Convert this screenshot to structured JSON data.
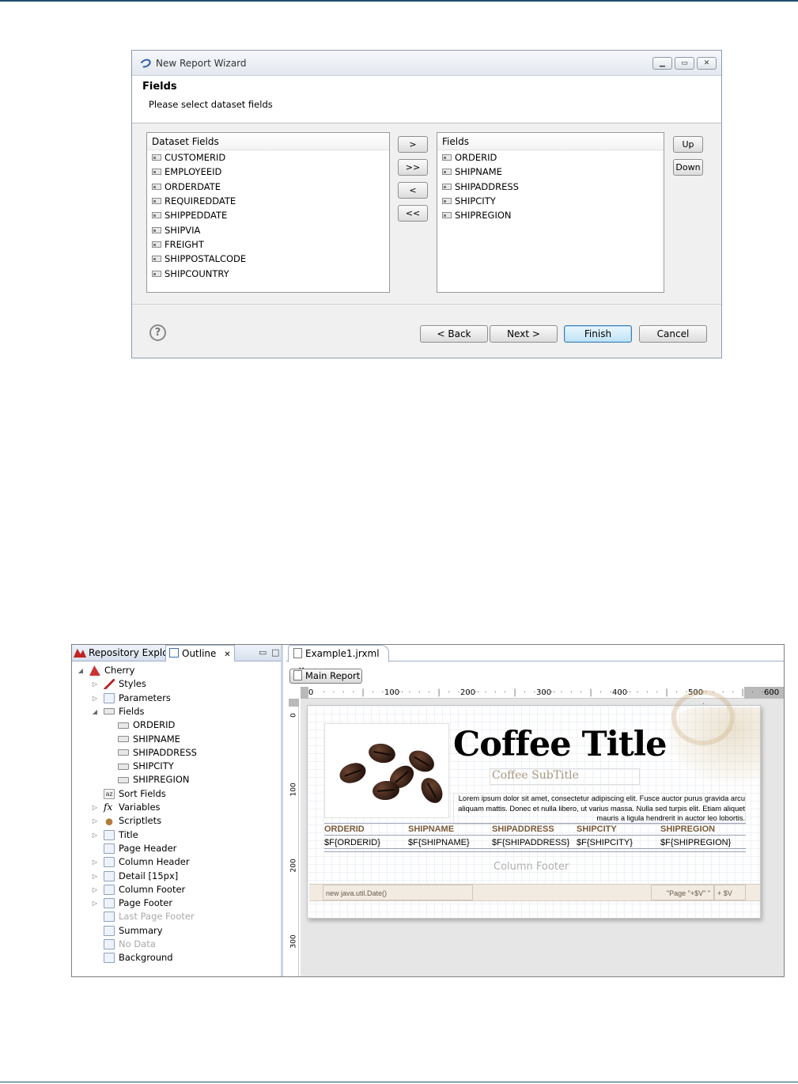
{
  "wizard": {
    "title": "New Report Wizard",
    "header_title": "Fields",
    "header_desc": "Please select dataset fields",
    "dataset_fields_label": "Dataset Fields",
    "dataset_fields": [
      "CUSTOMERID",
      "EMPLOYEEID",
      "ORDERDATE",
      "REQUIREDDATE",
      "SHIPPEDDATE",
      "SHIPVIA",
      "FREIGHT",
      "SHIPPOSTALCODE",
      "SHIPCOUNTRY"
    ],
    "fields_label": "Fields",
    "fields": [
      "ORDERID",
      "SHIPNAME",
      "SHIPADDRESS",
      "SHIPCITY",
      "SHIPREGION"
    ],
    "move_buttons": {
      "add": ">",
      "add_all": ">>",
      "remove": "<",
      "remove_all": "<<"
    },
    "order_buttons": {
      "up": "Up",
      "down": "Down"
    },
    "dialog_buttons": {
      "back": "< Back",
      "next": "Next >",
      "finish": "Finish",
      "cancel": "Cancel"
    },
    "help": "?"
  },
  "ide": {
    "tabs": {
      "repository": "Repository Explore",
      "outline": "Outline"
    },
    "tree": {
      "root": "Cherry",
      "items": [
        {
          "label": "Styles",
          "twisty": "▷",
          "icon": "pen",
          "indent": 1
        },
        {
          "label": "Parameters",
          "twisty": "▷",
          "icon": "doc",
          "indent": 1
        },
        {
          "label": "Fields",
          "twisty": "◢",
          "icon": "field",
          "indent": 1
        },
        {
          "label": "ORDERID",
          "twisty": "",
          "icon": "field",
          "indent": 2
        },
        {
          "label": "SHIPNAME",
          "twisty": "",
          "icon": "field",
          "indent": 2
        },
        {
          "label": "SHIPADDRESS",
          "twisty": "",
          "icon": "field",
          "indent": 2
        },
        {
          "label": "SHIPCITY",
          "twisty": "",
          "icon": "field",
          "indent": 2
        },
        {
          "label": "SHIPREGION",
          "twisty": "",
          "icon": "field",
          "indent": 2
        },
        {
          "label": "Sort Fields",
          "twisty": "",
          "icon": "az",
          "indent": 1
        },
        {
          "label": "Variables",
          "twisty": "▷",
          "icon": "fx",
          "indent": 1
        },
        {
          "label": "Scriptlets",
          "twisty": "▷",
          "icon": "cup",
          "indent": 1
        },
        {
          "label": "Title",
          "twisty": "▷",
          "icon": "doc",
          "indent": 1
        },
        {
          "label": "Page Header",
          "twisty": "",
          "icon": "doc",
          "indent": 1
        },
        {
          "label": "Column Header",
          "twisty": "▷",
          "icon": "doc",
          "indent": 1
        },
        {
          "label": "Detail [15px]",
          "twisty": "▷",
          "icon": "doc",
          "indent": 1
        },
        {
          "label": "Column Footer",
          "twisty": "▷",
          "icon": "doc",
          "indent": 1
        },
        {
          "label": "Page Footer",
          "twisty": "▷",
          "icon": "doc",
          "indent": 1
        },
        {
          "label": "Last Page Footer",
          "twisty": "",
          "icon": "doc",
          "indent": 1,
          "disabled": true
        },
        {
          "label": "Summary",
          "twisty": "",
          "icon": "doc",
          "indent": 1
        },
        {
          "label": "No Data",
          "twisty": "",
          "icon": "doc",
          "indent": 1,
          "disabled": true
        },
        {
          "label": "Background",
          "twisty": "",
          "icon": "doc",
          "indent": 1
        }
      ]
    },
    "editor_tab": "Example1.jrxml",
    "main_report_button": "Main Report",
    "ruler_h": [
      "0",
      "100",
      "200",
      "300",
      "400",
      "500",
      "600"
    ],
    "ruler_v": [
      "0",
      "100",
      "200",
      "300"
    ],
    "report": {
      "title": "Coffee Title",
      "subtitle": "Coffee SubTitle",
      "lorem": "Lorem ipsum dolor sit amet, consectetur adipiscing elit. Fusce auctor purus gravida arcu aliquam mattis. Donec et nulla libero, ut varius massa. Nulla sed turpis elit. Etiam aliquet mauris a ligula hendrerit in auctor leo lobortis.",
      "column_headers": [
        "ORDERID",
        "SHIPNAME",
        "SHIPADDRESS",
        "SHIPCITY",
        "SHIPREGION"
      ],
      "detail_fields": [
        "$F{ORDERID}",
        "$F{SHIPNAME}",
        "$F{SHIPADDRESS}",
        "$F{SHIPCITY}",
        "$F{SHIPREGION}"
      ],
      "column_footer": "Column Footer",
      "footer_date": "new java.util.Date()",
      "footer_page": "\"Page \"+$V\" \"",
      "footer_pv": "+ $V"
    }
  }
}
